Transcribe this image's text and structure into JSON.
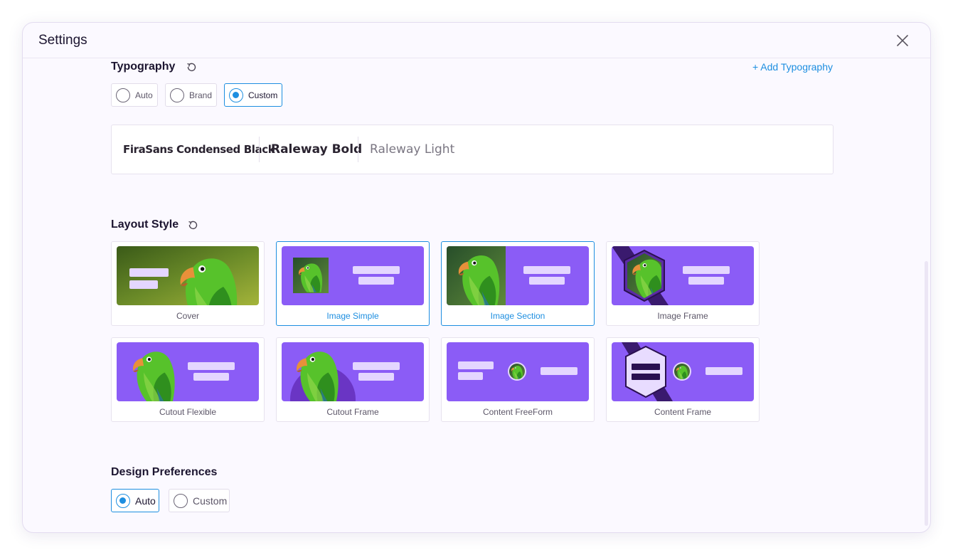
{
  "modal": {
    "title": "Settings"
  },
  "typography": {
    "title": "Typography",
    "add_label": "+ Add Typography",
    "options": [
      {
        "label": "Auto",
        "selected": false
      },
      {
        "label": "Brand",
        "selected": false
      },
      {
        "label": "Custom",
        "selected": true
      }
    ],
    "fonts": [
      "FiraSans Condensed Black",
      "Raleway Bold",
      "Raleway Light"
    ]
  },
  "layout_style": {
    "title": "Layout Style",
    "cards": [
      {
        "label": "Cover",
        "selected": false
      },
      {
        "label": "Image Simple",
        "selected": true
      },
      {
        "label": "Image Section",
        "selected": true
      },
      {
        "label": "Image Frame",
        "selected": false
      },
      {
        "label": "Cutout Flexible",
        "selected": false
      },
      {
        "label": "Cutout Frame",
        "selected": false
      },
      {
        "label": "Content FreeForm",
        "selected": false
      },
      {
        "label": "Content Frame",
        "selected": false
      }
    ]
  },
  "design_preferences": {
    "title": "Design Preferences",
    "options": [
      {
        "label": "Auto",
        "selected": true
      },
      {
        "label": "Custom",
        "selected": false
      }
    ]
  },
  "colors": {
    "accent": "#1d8ee0",
    "purple": "#8b5cf6",
    "purple_dark": "#5b2aa6"
  },
  "icons": {
    "close": "close-icon",
    "reset": "reset-icon",
    "parrot": "parrot-image"
  }
}
